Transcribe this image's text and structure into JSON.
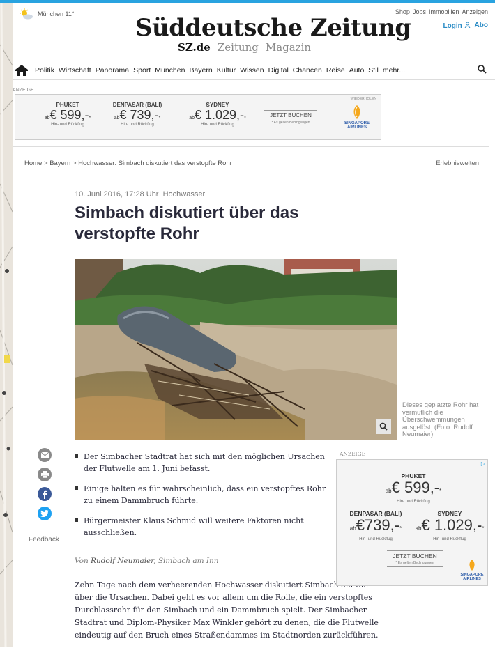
{
  "header": {
    "weather": "München 11°",
    "logo": "Süddeutsche Zeitung",
    "sub_nav": [
      "SZ.de",
      "Zeitung",
      "Magazin"
    ],
    "top_links": [
      "Shop",
      "Jobs",
      "Immobilien",
      "Anzeigen"
    ],
    "login": "Login",
    "abo": "Abo"
  },
  "nav": {
    "items": [
      "Politik",
      "Wirtschaft",
      "Panorama",
      "Sport",
      "München",
      "Bayern",
      "Kultur",
      "Wissen",
      "Digital",
      "Chancen",
      "Reise",
      "Auto",
      "Stil",
      "mehr..."
    ]
  },
  "ad_top": {
    "label": "ANZEIGE",
    "corner": "WIEDERHOLEN",
    "offers": [
      {
        "city": "PHUKET",
        "price": "€ 599,-",
        "prefix": "ab",
        "star": "*",
        "sub": "Hin- und Rückflug"
      },
      {
        "city": "DENPASAR (BALI)",
        "price": "€ 739,-",
        "prefix": "ab",
        "star": "*",
        "sub": "Hin- und Rückflug"
      },
      {
        "city": "SYDNEY",
        "price": "€ 1.029,-",
        "prefix": "ab",
        "star": "*",
        "sub": "Hin- und Rückflug"
      }
    ],
    "cta": "JETZT BUCHEN",
    "cta_note": "* Es gelten Bedingungen",
    "brand": "SINGAPORE AIRLINES"
  },
  "breadcrumb": {
    "items": [
      "Home",
      "Bayern",
      "Hochwasser: Simbach diskutiert das verstopfte Rohr"
    ],
    "separator": ">",
    "right": "Erlebniswelten"
  },
  "article": {
    "date": "10. Juni 2016, 17:28 Uhr",
    "topic": "Hochwasser",
    "headline": "Simbach diskutiert über das verstopfte Rohr",
    "caption": "Dieses geplatzte Rohr hat vermutlich die Überschwemmungen ausgelöst. (Foto: Rudolf Neumaier)",
    "bullets": [
      "Der Simbacher Stadtrat hat sich mit den möglichen Ursachen der Flutwelle am 1. Juni befasst.",
      "Einige halten es für wahrscheinlich, dass ein verstopftes Rohr zu einem Dammbruch führte.",
      "Bürgermeister Klaus Schmid will weitere Faktoren nicht ausschließen."
    ],
    "byline_prefix": "Von",
    "author": "Rudolf Neumaier",
    "byline_suffix": ", Simbach am Inn",
    "body": "Zehn Tage nach dem verheerenden Hochwasser diskutiert Simbach am Inn über die Ursachen. Dabei geht es vor allem um die Rolle, die ein verstopftes Durchlassrohr für den Simbach und ein Dammbruch spielt. Der Simbacher Stadtrat und Diplom-Physiker Max Winkler gehört zu denen, die die Flutwelle eindeutig auf den Bruch eines Straßendammes im Stadtnorden zurückführen."
  },
  "share": {
    "feedback": "Feedback"
  },
  "ad_side": {
    "label": "ANZEIGE",
    "offers": [
      {
        "city": "PHUKET",
        "price": "€ 599,-",
        "prefix": "ab",
        "star": "*",
        "sub": "Hin- und Rückflug"
      },
      {
        "city": "DENPASAR (BALI)",
        "price": "€739,-",
        "prefix": "ab",
        "star": "*",
        "sub": "Hin- und Rückflug"
      },
      {
        "city": "SYDNEY",
        "price": "€ 1.029,-",
        "prefix": "ab",
        "star": "*",
        "sub": "Hin- und Rückflug"
      }
    ],
    "cta": "JETZT BUCHEN",
    "cta_note": "* Es gelten Bedingungen",
    "brand": "SINGAPORE AIRLINES"
  },
  "colors": {
    "accent": "#29a3e0",
    "link": "#2a8bc5",
    "text": "#29293a",
    "facebook": "#3b5998",
    "twitter": "#1da1f2",
    "share_gray": "#8a8a8a"
  },
  "icons": [
    "sun-cloud-icon",
    "user-icon",
    "home-icon",
    "search-icon",
    "email-icon",
    "print-icon",
    "facebook-icon",
    "twitter-icon",
    "zoom-icon",
    "play-icon"
  ]
}
